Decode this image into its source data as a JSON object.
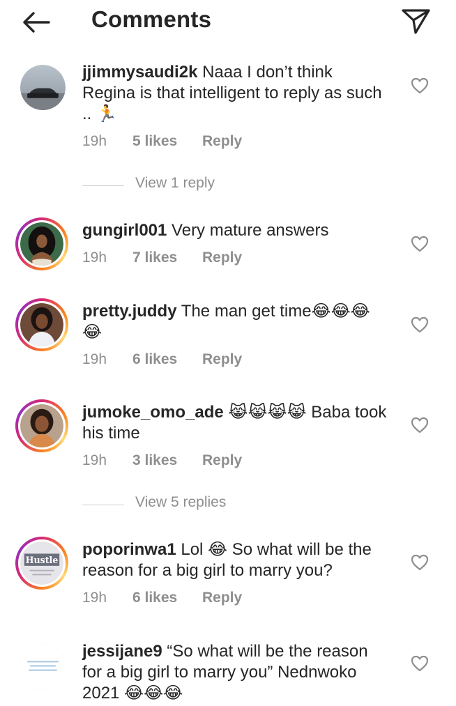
{
  "header": {
    "title": "Comments",
    "back_icon": "arrow-left-icon",
    "send_icon": "paper-plane-icon"
  },
  "comments": [
    {
      "username": "jjimmysaudi2k",
      "text": "Naaa I don’t think Regina is that intelligent to reply as such .. 🏃",
      "time": "19h",
      "likes": "5 likes",
      "reply": "Reply",
      "story_ring": false
    },
    {
      "username": "gungirl001",
      "text": "Very mature answers",
      "time": "19h",
      "likes": "7 likes",
      "reply": "Reply",
      "story_ring": true
    },
    {
      "username": "pretty.juddy",
      "text": "The man get time😂😂😂😂",
      "time": "19h",
      "likes": "6 likes",
      "reply": "Reply",
      "story_ring": true
    },
    {
      "username": "jumoke_omo_ade",
      "text": "😹😹😹😹 Baba took his time",
      "time": "19h",
      "likes": "3 likes",
      "reply": "Reply",
      "story_ring": true
    },
    {
      "username": "poporinwa1",
      "text": "Lol 😂 So what will be the reason for a big girl to marry you?",
      "time": "19h",
      "likes": "6 likes",
      "reply": "Reply",
      "story_ring": true,
      "avatar_text": "Hustle"
    },
    {
      "username": "jessijane9",
      "text": "“So what will be the reason for a big girl to marry you” Nednwoko 2021 😂😂😂",
      "story_ring": false
    }
  ],
  "view_replies": [
    "View 1 reply",
    "View 5 replies"
  ],
  "colors": {
    "text": "#262626",
    "secondary": "#8e8e8e",
    "divider": "#cfcfcf",
    "ring_start": "#d62976",
    "ring_end": "#fa7e1e"
  },
  "icons": {
    "heart": "heart-outline-icon",
    "avatar": "avatar"
  }
}
